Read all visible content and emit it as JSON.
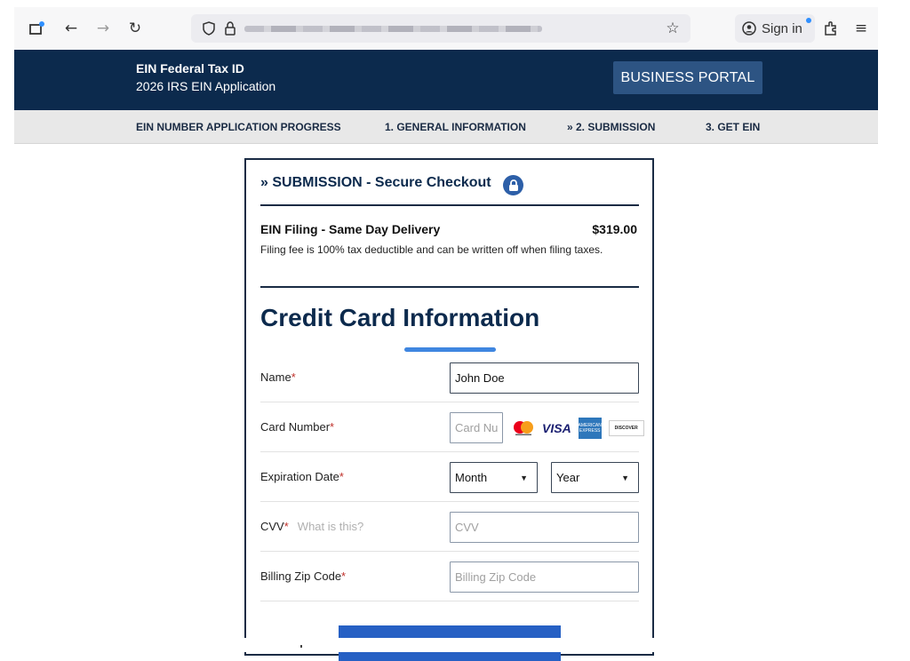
{
  "browser": {
    "signin_label": "Sign in"
  },
  "header": {
    "brand_title": "EIN Federal Tax ID",
    "brand_subtitle": "2026 IRS EIN Application",
    "portal_button": "BUSINESS PORTAL",
    "colors": {
      "header_bg": "#0c2a4d",
      "portal_button_bg": "#2d5483"
    }
  },
  "progress": {
    "label": "EIN NUMBER APPLICATION PROGRESS",
    "steps": [
      {
        "label": "1. GENERAL INFORMATION"
      },
      {
        "label": "» 2. SUBMISSION",
        "current": true
      },
      {
        "label": "3. GET EIN"
      }
    ]
  },
  "checkout": {
    "title": "» SUBMISSION - Secure Checkout",
    "item_name": "EIN Filing - Same Day Delivery",
    "item_price": "$319.00",
    "item_note": "Filing fee is 100% tax deductible and can be written off when filing taxes.",
    "section_heading": "Credit Card Information",
    "fields": {
      "name": {
        "label": "Name",
        "required": "*",
        "value": "John Doe"
      },
      "card_number": {
        "label": "Card Number",
        "required": "*",
        "placeholder": "Card Nu"
      },
      "expiration": {
        "label": "Expiration Date",
        "required": "*",
        "month_value": "Month",
        "year_value": "Year"
      },
      "cvv": {
        "label": "CVV",
        "required": "*",
        "help": "What is this?",
        "placeholder": "CVV"
      },
      "zip": {
        "label": "Billing Zip Code",
        "required": "*",
        "placeholder": "Billing Zip Code"
      }
    },
    "card_logos": [
      "mastercard-icon",
      "visa-icon",
      "amex-icon",
      "discover-icon"
    ],
    "logo_text": {
      "visa": "VISA",
      "amex": "AMERICAN EXPRESS",
      "discover": "DISCOVER"
    },
    "colors": {
      "accent": "#3f86e0",
      "submit_bg": "#2660c4",
      "required": "#c0312b"
    }
  }
}
